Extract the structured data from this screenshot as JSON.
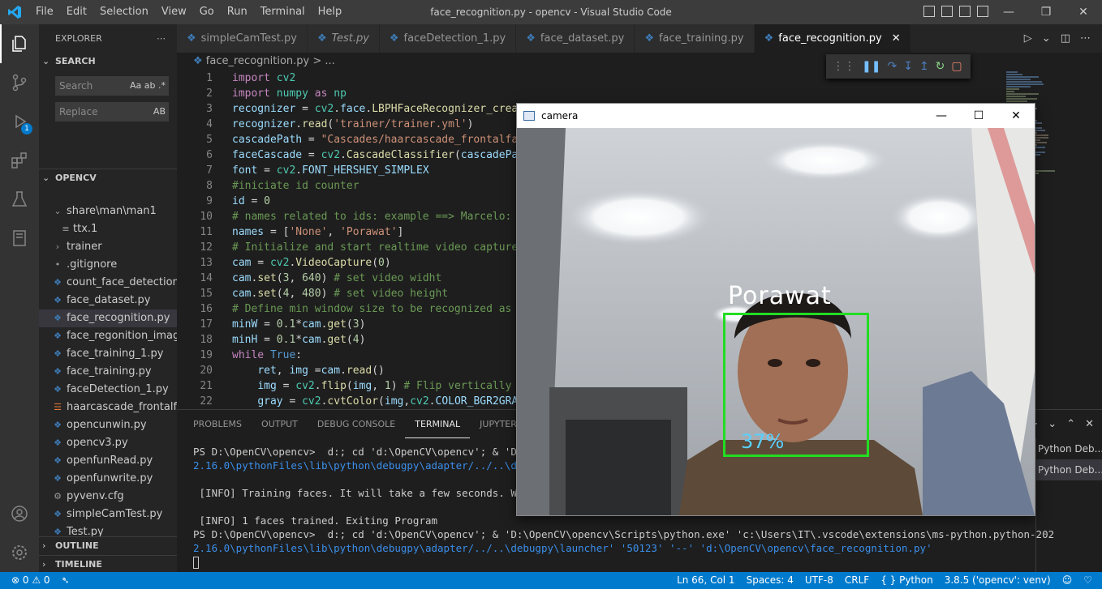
{
  "titlebar": {
    "title": "face_recognition.py - opencv - Visual Studio Code",
    "menu": [
      "File",
      "Edit",
      "Selection",
      "View",
      "Go",
      "Run",
      "Terminal",
      "Help"
    ]
  },
  "activity": {
    "debug_badge": "1"
  },
  "sidebar": {
    "header": "EXPLORER",
    "search_title": "SEARCH",
    "search_placeholder": "Search",
    "search_opts": "Aa ab .*",
    "replace_placeholder": "Replace",
    "replace_opt": "AB",
    "folder_title": "OPENCV",
    "items": [
      {
        "label": "share\\man\\man1",
        "icon": "chevron-down"
      },
      {
        "label": "ttx.1",
        "icon": "lines"
      },
      {
        "label": "trainer",
        "icon": "chevron-right"
      },
      {
        "label": ".gitignore",
        "icon": "dot"
      },
      {
        "label": "count_face_detection...",
        "icon": "python"
      },
      {
        "label": "face_dataset.py",
        "icon": "python"
      },
      {
        "label": "face_recognition.py",
        "icon": "python"
      },
      {
        "label": "face_regonition_imag...",
        "icon": "python"
      },
      {
        "label": "face_training_1.py",
        "icon": "python"
      },
      {
        "label": "face_training.py",
        "icon": "python"
      },
      {
        "label": "faceDetection_1.py",
        "icon": "python"
      },
      {
        "label": "haarcascade_frontalfa...",
        "icon": "rss"
      },
      {
        "label": "opencunwin.py",
        "icon": "python"
      },
      {
        "label": "opencv3.py",
        "icon": "python"
      },
      {
        "label": "openfunRead.py",
        "icon": "python"
      },
      {
        "label": "openfunwrite.py",
        "icon": "python"
      },
      {
        "label": "pyvenv.cfg",
        "icon": "gear"
      },
      {
        "label": "simpleCamTest.py",
        "icon": "python"
      },
      {
        "label": "Test.py",
        "icon": "python"
      }
    ],
    "outline": "OUTLINE",
    "timeline": "TIMELINE"
  },
  "tabs": [
    "simpleCamTest.py",
    "Test.py",
    "faceDetection_1.py",
    "face_dataset.py",
    "face_training.py",
    "face_recognition.py"
  ],
  "breadcrumb": "face_recognition.py > ...",
  "editor": {
    "line_numbers": [
      "1",
      "2",
      "3",
      "4",
      "5",
      "6",
      "7",
      "8",
      "9",
      "10",
      "11",
      "12",
      "13",
      "14",
      "15",
      "16",
      "17",
      "18",
      "19",
      "20",
      "21",
      "22"
    ]
  },
  "panel": {
    "tabs": [
      "PROBLEMS",
      "OUTPUT",
      "DEBUG CONSOLE",
      "TERMINAL",
      "JUPYTER"
    ],
    "terminal_lines": [
      "PS D:\\OpenCV\\opencv>  d:; cd 'd:\\OpenCV\\opencv'; & 'D:\\Op",
      "2.16.0\\pythonFiles\\lib\\python\\debugpy\\adapter/../..\\debug",
      "",
      " [INFO] Training faces. It will take a few seconds. Wait",
      "",
      " [INFO] 1 faces trained. Exiting Program",
      "PS D:\\OpenCV\\opencv>  d:; cd 'd:\\OpenCV\\opencv'; & 'D:\\OpenCV\\opencv\\Scripts\\python.exe' 'c:\\Users\\IT\\.vscode\\extensions\\ms-python.python-202",
      "2.16.0\\pythonFiles\\lib\\python\\debugpy\\adapter/../..\\debugpy\\launcher' '50123' '--' 'd:\\OpenCV\\opencv\\face_recognition.py'"
    ],
    "terminal_list": [
      "Python Deb...",
      "Python Deb..."
    ]
  },
  "statusbar": {
    "problems": "0",
    "warnings": "0",
    "position": "Ln 66, Col 1",
    "spaces": "Spaces: 4",
    "encoding": "UTF-8",
    "eol": "CRLF",
    "language": "Python",
    "interpreter": "3.8.5 ('opencv': venv)"
  },
  "camera": {
    "title": "camera",
    "name": "Porawat",
    "confidence": "37%"
  },
  "colors": {
    "accent": "#007acc",
    "box": "#22dd22"
  }
}
